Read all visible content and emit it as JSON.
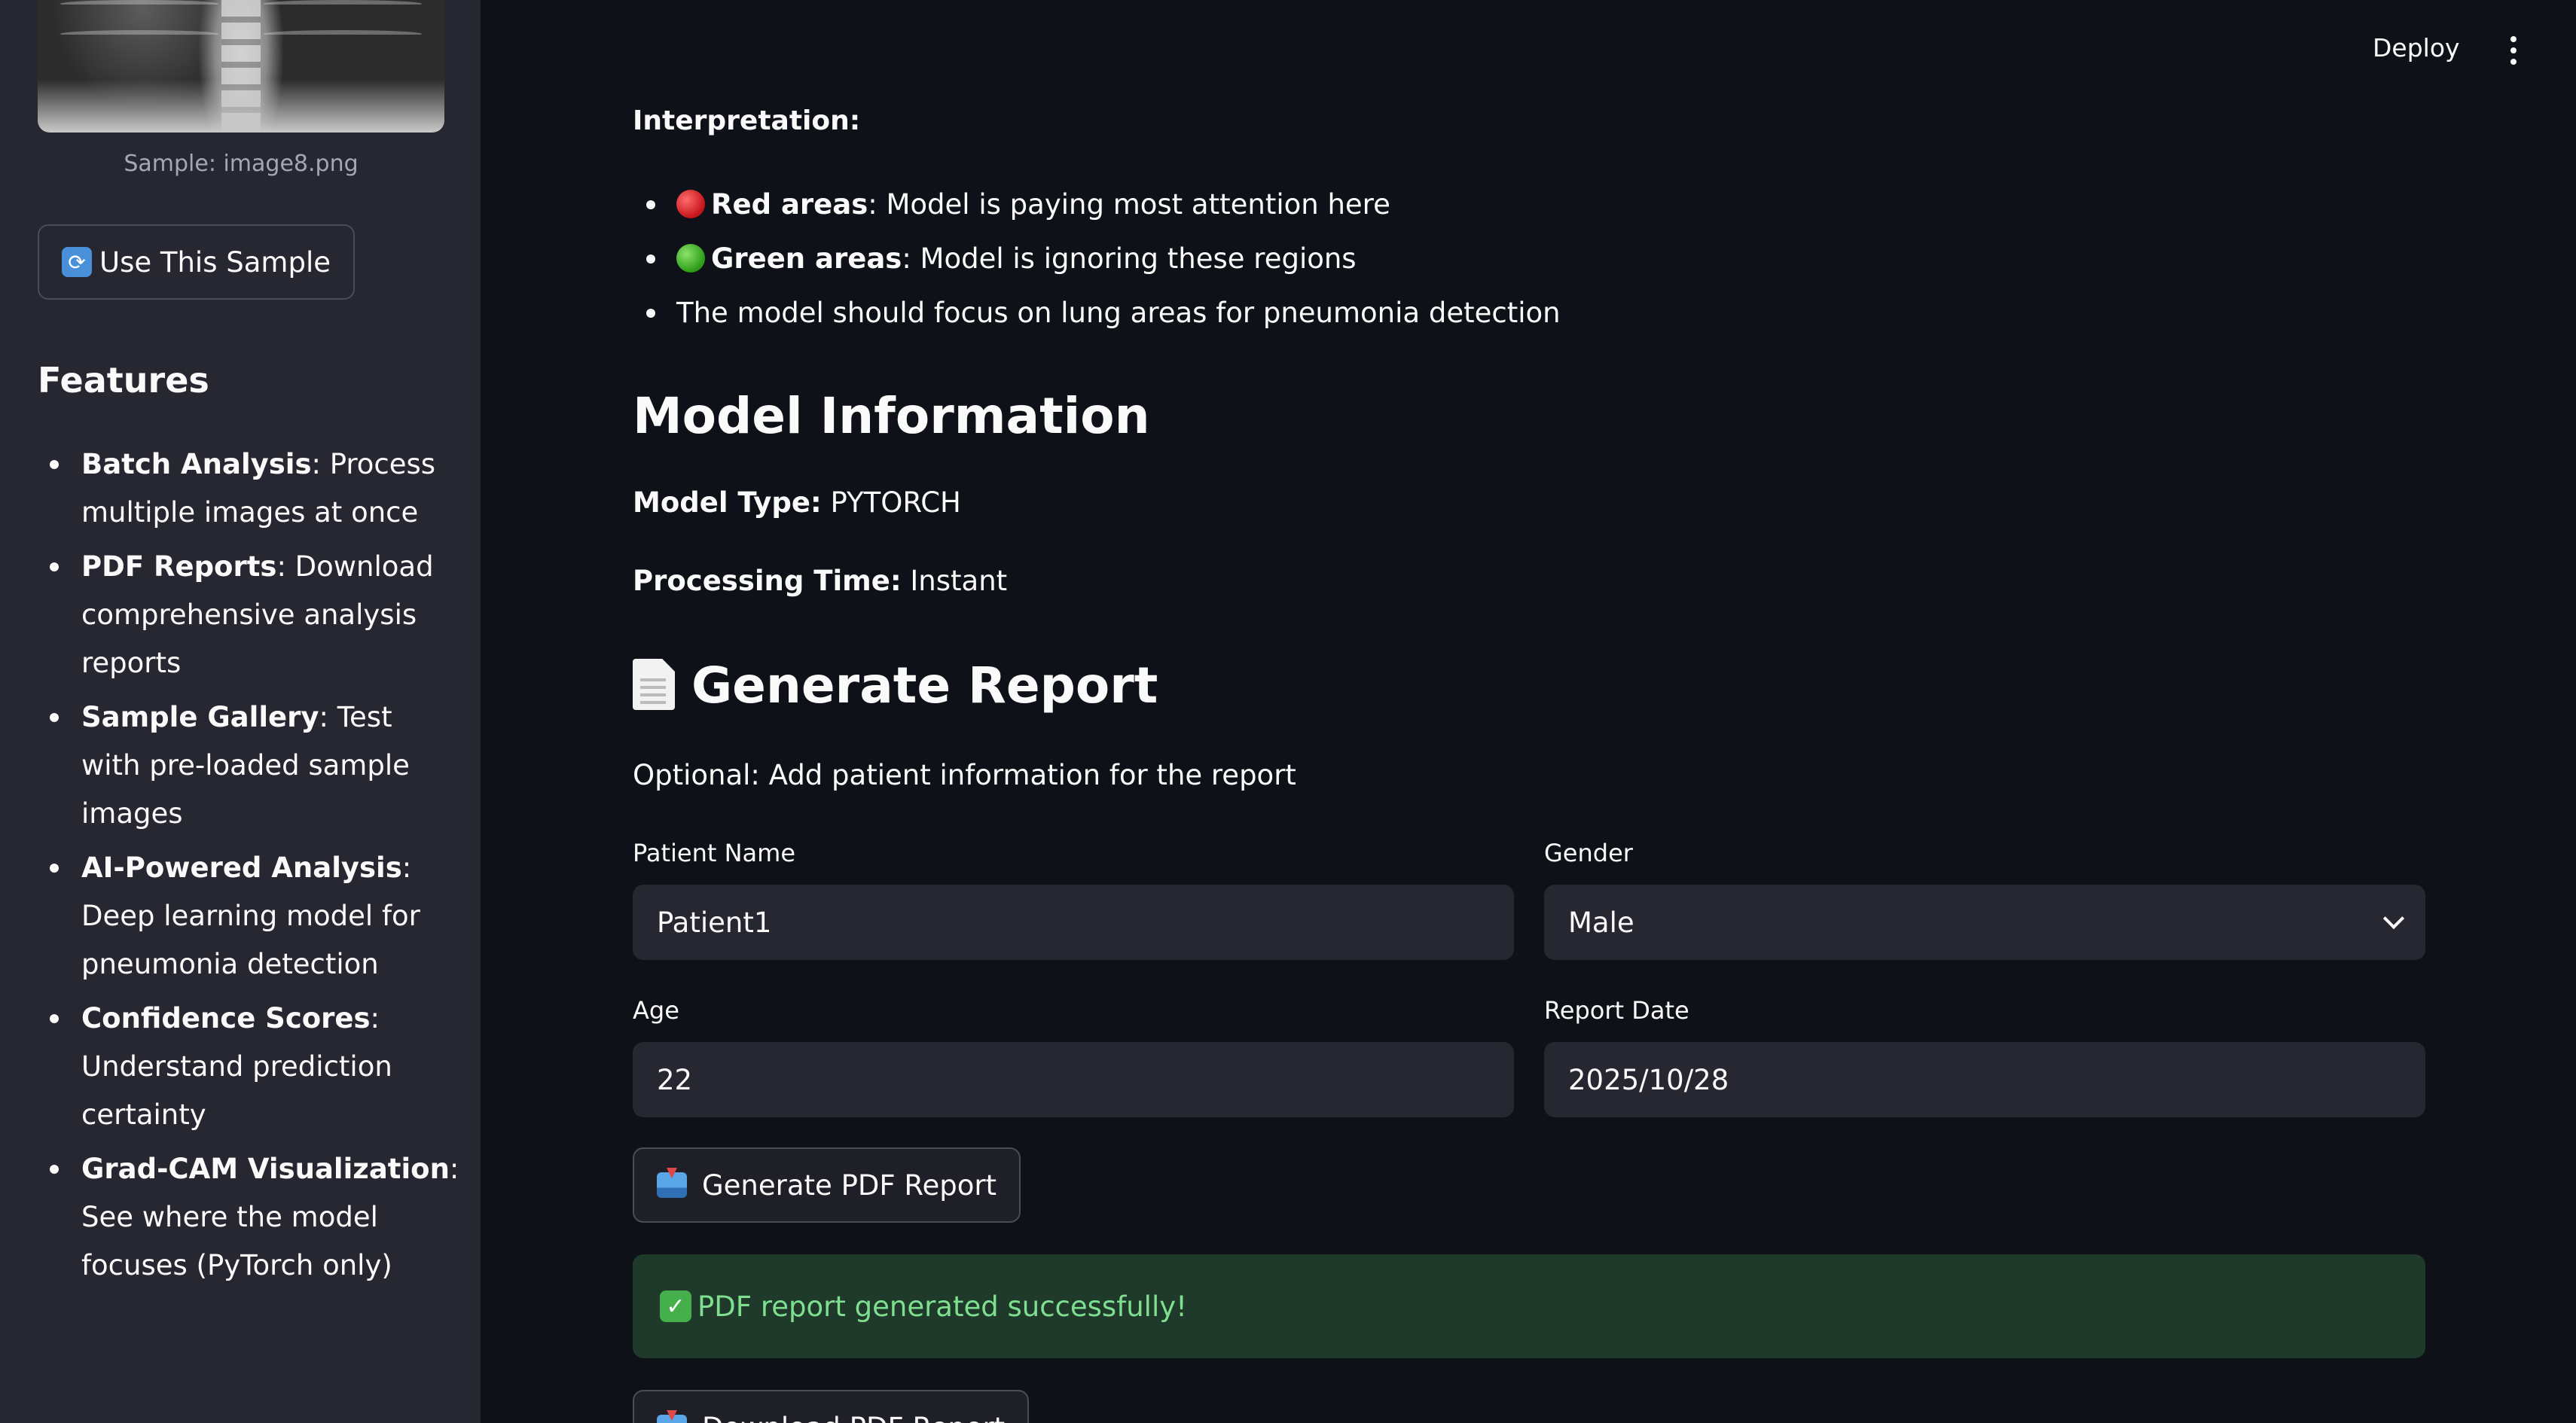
{
  "header": {
    "deploy_label": "Deploy",
    "menu_icon": "more-vert-icon"
  },
  "sidebar": {
    "sample_caption": "Sample: image8.png",
    "use_sample_label": "Use This Sample",
    "use_sample_icon": "refresh-icon",
    "features_title": "Features",
    "features": [
      {
        "title": "Batch Analysis",
        "text": ": Process multiple images at once"
      },
      {
        "title": "PDF Reports",
        "text": ": Download comprehensive analysis reports"
      },
      {
        "title": "Sample Gallery",
        "text": ": Test with pre-loaded sample images"
      },
      {
        "title": "AI-Powered Analysis",
        "text": ": Deep learning model for pneumonia detection"
      },
      {
        "title": "Confidence Scores",
        "text": ": Understand prediction certainty"
      },
      {
        "title": "Grad-CAM Visualization",
        "text": ": See where the model focuses (PyTorch only)"
      }
    ]
  },
  "interpretation": {
    "title": "Interpretation:",
    "items": [
      {
        "icon": "red-circle-icon",
        "bold": "Red areas",
        "text": ": Model is paying most attention here"
      },
      {
        "icon": "green-circle-icon",
        "bold": "Green areas",
        "text": ": Model is ignoring these regions"
      },
      {
        "icon": "",
        "bold": "",
        "text": "The model should focus on lung areas for pneumonia detection"
      }
    ]
  },
  "model_info": {
    "title": "Model Information",
    "type_label": "Model Type:",
    "type_value": "PYTORCH",
    "time_label": "Processing Time:",
    "time_value": "Instant"
  },
  "report": {
    "title": "Generate Report",
    "title_icon": "document-icon",
    "subtitle": "Optional: Add patient information for the report",
    "patient_name_label": "Patient Name",
    "patient_name_value": "Patient1",
    "gender_label": "Gender",
    "gender_value": "Male",
    "age_label": "Age",
    "age_value": "22",
    "date_label": "Report Date",
    "date_value": "2025/10/28",
    "generate_label": "Generate PDF Report",
    "generate_icon": "inbox-tray-icon",
    "success_message": "PDF report generated successfully!",
    "success_icon": "check-mark-icon",
    "download_label": "Download PDF Report",
    "download_icon": "inbox-tray-icon"
  },
  "colors": {
    "background": "#0e1117",
    "sidebar": "#262730",
    "input": "#262730",
    "success_bg": "#1f3a2a",
    "success_text": "#7ddf8f"
  }
}
